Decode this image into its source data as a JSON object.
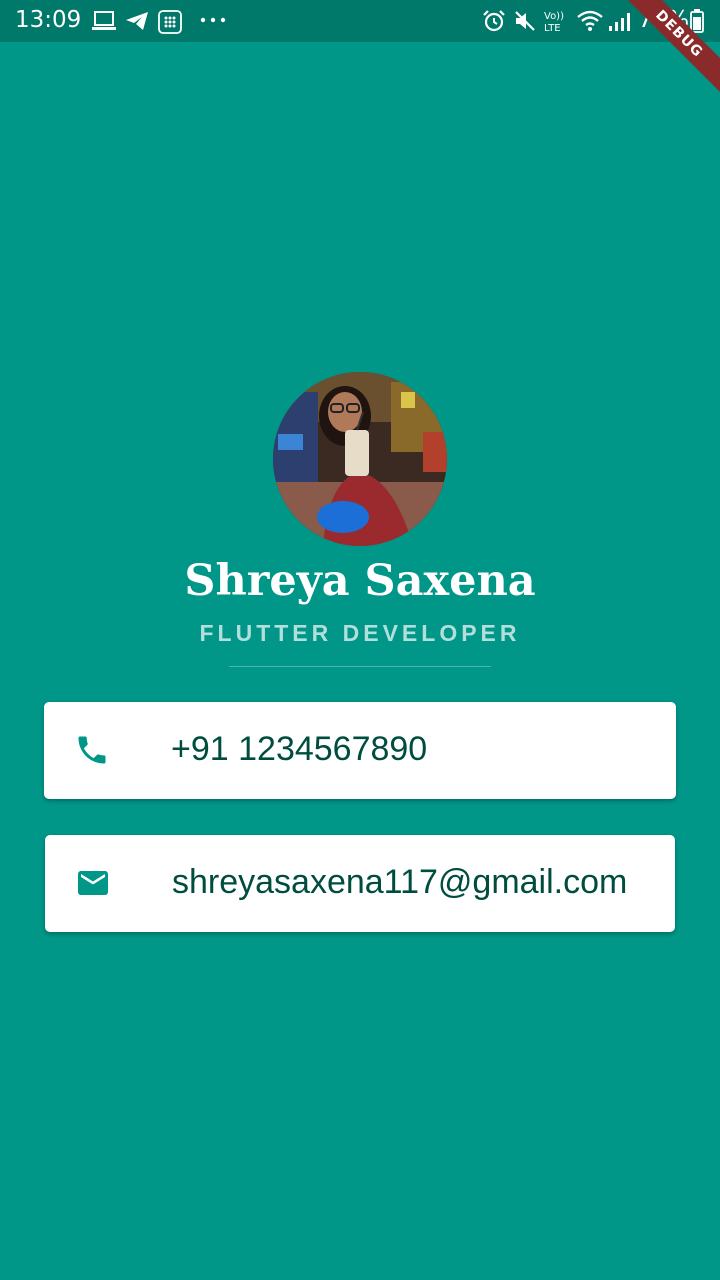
{
  "status_bar": {
    "time": "13:09",
    "battery_percent": "75%",
    "left_icons": [
      "laptop-icon",
      "telegram-icon",
      "app-grid-icon",
      "more-dots-icon"
    ],
    "right_icons": [
      "alarm-icon",
      "mute-icon",
      "volte-icon",
      "wifi-icon",
      "signal-icon",
      "battery-icon"
    ]
  },
  "debug_banner": "DEBUG",
  "profile": {
    "name": "Shreya Saxena",
    "title": "FLUTTER DEVELOPER"
  },
  "contacts": {
    "phone": {
      "icon": "phone-icon",
      "value": "+91 1234567890"
    },
    "email": {
      "icon": "mail-icon",
      "value": "shreyasaxena117@gmail.com"
    }
  },
  "colors": {
    "background": "#009688",
    "status_bar": "#00796b",
    "card": "#ffffff",
    "card_text": "#004d40",
    "subtitle": "#b2dfdb",
    "debug_ribbon": "#8a2a2a"
  }
}
